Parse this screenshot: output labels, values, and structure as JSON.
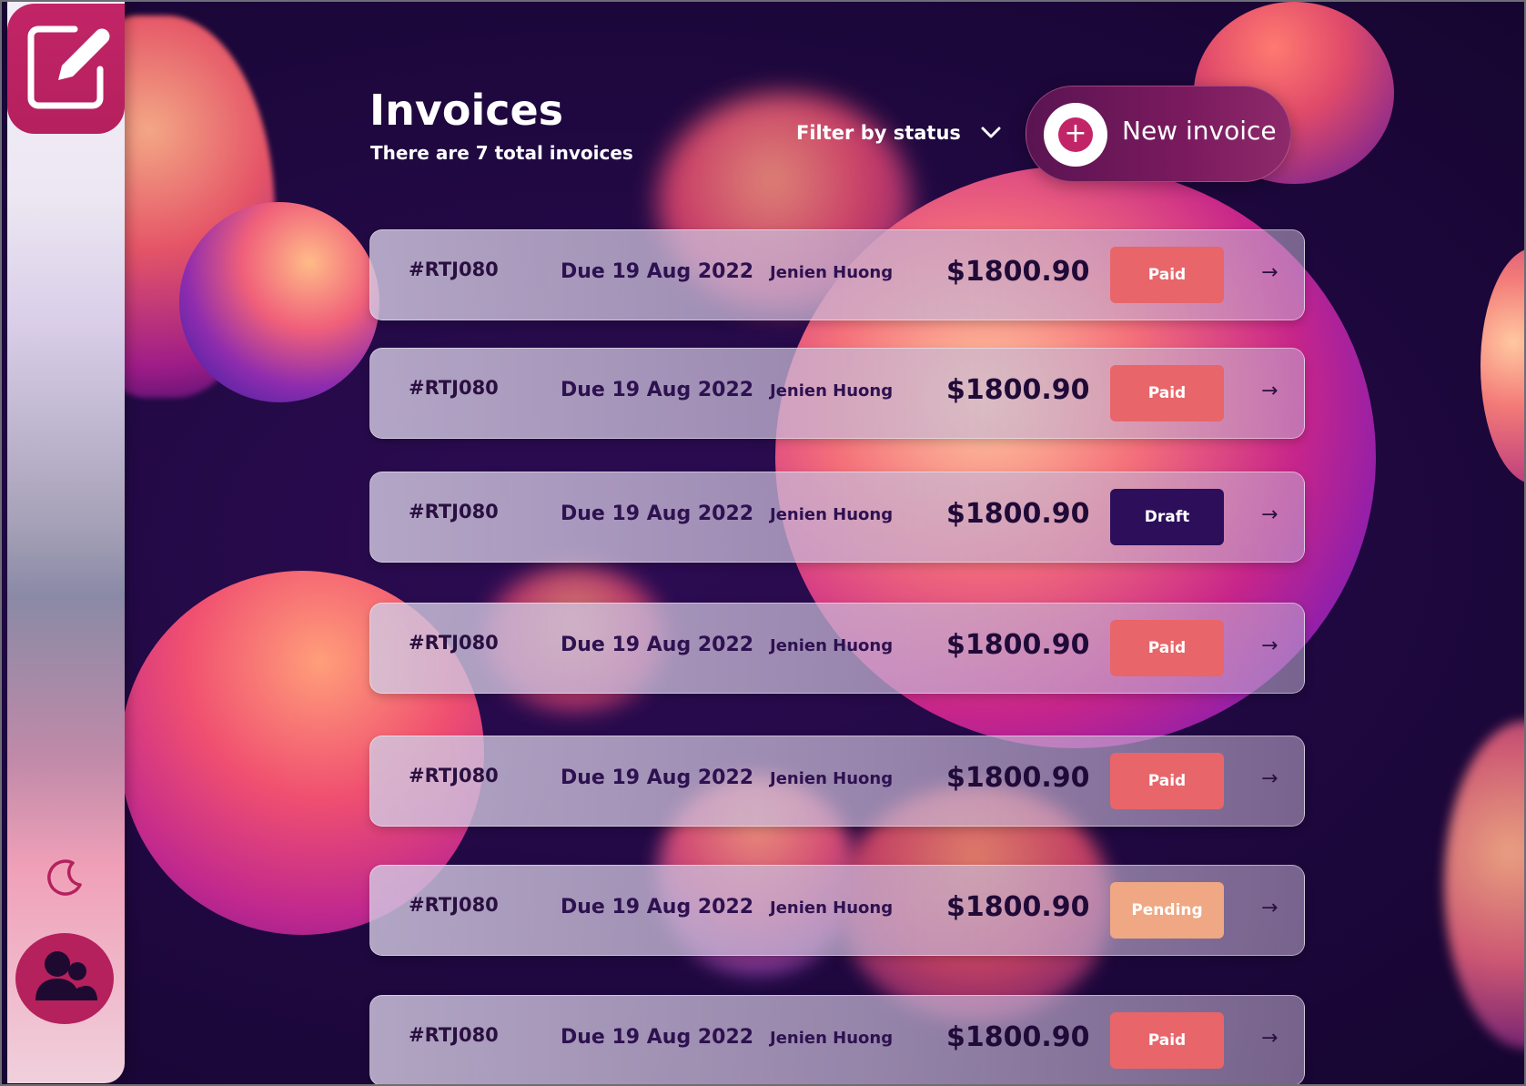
{
  "header": {
    "title": "Invoices",
    "subtitle": "There are 7 total invoices",
    "filter_label": "Filter by status",
    "new_invoice_label": "New invoice"
  },
  "sidebar": {
    "logo_icon": "edit-icon",
    "theme_icon": "moon-icon",
    "avatar_icon": "users-icon"
  },
  "colors": {
    "brand": "#c22567",
    "paid": "#e8656a",
    "draft": "#2c0e5a",
    "pending": "#efa883"
  },
  "invoices": [
    {
      "id": "#RTJ080",
      "due": "Due 19 Aug 2022",
      "client": "Jenien Huong",
      "amount": "$1800.90",
      "status": "Paid",
      "arrow": "→"
    },
    {
      "id": "#RTJ080",
      "due": "Due 19 Aug 2022",
      "client": "Jenien Huong",
      "amount": "$1800.90",
      "status": "Paid",
      "arrow": "→"
    },
    {
      "id": "#RTJ080",
      "due": "Due 19 Aug 2022",
      "client": "Jenien Huong",
      "amount": "$1800.90",
      "status": "Draft",
      "arrow": "→"
    },
    {
      "id": "#RTJ080",
      "due": "Due 19 Aug 2022",
      "client": "Jenien Huong",
      "amount": "$1800.90",
      "status": "Paid",
      "arrow": "→"
    },
    {
      "id": "#RTJ080",
      "due": "Due 19 Aug 2022",
      "client": "Jenien Huong",
      "amount": "$1800.90",
      "status": "Paid",
      "arrow": "→"
    },
    {
      "id": "#RTJ080",
      "due": "Due 19 Aug 2022",
      "client": "Jenien Huong",
      "amount": "$1800.90",
      "status": "Pending",
      "arrow": "→"
    },
    {
      "id": "#RTJ080",
      "due": "Due 19 Aug 2022",
      "client": "Jenien Huong",
      "amount": "$1800.90",
      "status": "Paid",
      "arrow": "→"
    }
  ]
}
